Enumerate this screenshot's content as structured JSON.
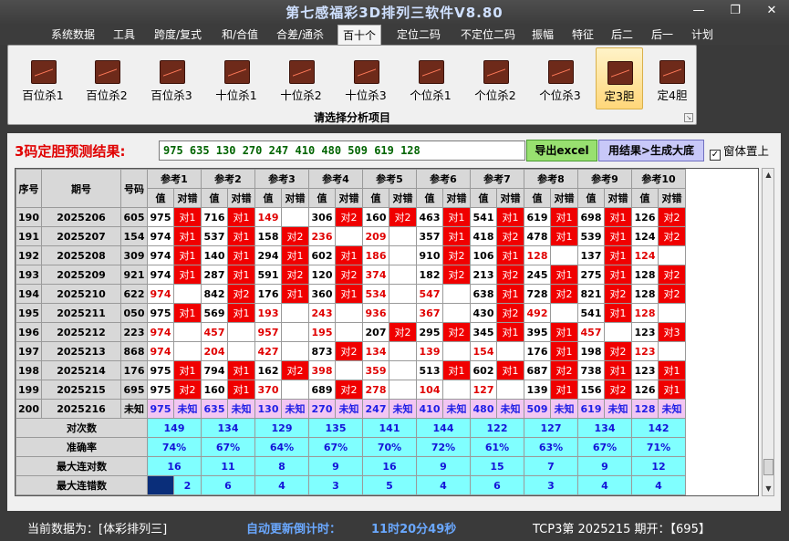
{
  "window": {
    "title": "第七感福彩3D排列三软件V8.80"
  },
  "menu": [
    "系统数据",
    "工具",
    "跨度/复式",
    "和/合值",
    "合差/通杀",
    "百十个",
    "定位二码",
    "不定位二码",
    "振幅",
    "特征",
    "后二",
    "后一",
    "计划"
  ],
  "menu_active": 5,
  "ribbon": {
    "buttons": [
      "百位杀1",
      "百位杀2",
      "百位杀3",
      "十位杀1",
      "十位杀2",
      "十位杀3",
      "个位杀1",
      "个位杀2",
      "个位杀3",
      "定3胆",
      "定4胆"
    ],
    "selected": 9,
    "caption": "请选择分析项目"
  },
  "result": {
    "label": "3码定胆预测结果:",
    "value": "975 635 130 270 247 410 480 509 619 128",
    "excel_button": "导出excel",
    "gen_button": "用结果>生成大底",
    "topmost_label": "窗体置上"
  },
  "table": {
    "headers": {
      "seq": "序号",
      "period": "期号",
      "code": "号码",
      "val": "值",
      "match": "对错"
    },
    "refs": [
      "参考1",
      "参考2",
      "参考3",
      "参考4",
      "参考5",
      "参考6",
      "参考7",
      "参考8",
      "参考9",
      "参考10"
    ],
    "rows": [
      {
        "seq": "190",
        "period": "2025206",
        "code": "605",
        "cells": [
          [
            "975",
            "对1"
          ],
          [
            "716",
            "对1"
          ],
          [
            "149",
            ""
          ],
          [
            "306",
            "对2"
          ],
          [
            "160",
            "对2"
          ],
          [
            "463",
            "对1"
          ],
          [
            "541",
            "对1"
          ],
          [
            "619",
            "对1"
          ],
          [
            "698",
            "对1"
          ],
          [
            "126",
            "对2"
          ]
        ]
      },
      {
        "seq": "191",
        "period": "2025207",
        "code": "154",
        "cells": [
          [
            "974",
            "对1"
          ],
          [
            "537",
            "对1"
          ],
          [
            "158",
            "对2"
          ],
          [
            "236",
            ""
          ],
          [
            "209",
            ""
          ],
          [
            "357",
            "对1"
          ],
          [
            "418",
            "对2"
          ],
          [
            "478",
            "对1"
          ],
          [
            "539",
            "对1"
          ],
          [
            "124",
            "对2"
          ]
        ]
      },
      {
        "seq": "192",
        "period": "2025208",
        "code": "309",
        "cells": [
          [
            "974",
            "对1"
          ],
          [
            "140",
            "对1"
          ],
          [
            "294",
            "对1"
          ],
          [
            "602",
            "对1"
          ],
          [
            "186",
            ""
          ],
          [
            "910",
            "对2"
          ],
          [
            "106",
            "对1"
          ],
          [
            "128",
            ""
          ],
          [
            "137",
            "对1"
          ],
          [
            "124",
            ""
          ]
        ]
      },
      {
        "seq": "193",
        "period": "2025209",
        "code": "921",
        "cells": [
          [
            "974",
            "对1"
          ],
          [
            "287",
            "对1"
          ],
          [
            "591",
            "对2"
          ],
          [
            "120",
            "对2"
          ],
          [
            "374",
            ""
          ],
          [
            "182",
            "对2"
          ],
          [
            "213",
            "对2"
          ],
          [
            "245",
            "对1"
          ],
          [
            "275",
            "对1"
          ],
          [
            "128",
            "对2"
          ]
        ]
      },
      {
        "seq": "194",
        "period": "2025210",
        "code": "622",
        "cells": [
          [
            "974",
            ""
          ],
          [
            "842",
            "对2"
          ],
          [
            "176",
            "对1"
          ],
          [
            "360",
            "对1"
          ],
          [
            "534",
            ""
          ],
          [
            "547",
            ""
          ],
          [
            "638",
            "对1"
          ],
          [
            "728",
            "对2"
          ],
          [
            "821",
            "对2"
          ],
          [
            "128",
            "对2"
          ]
        ]
      },
      {
        "seq": "195",
        "period": "2025211",
        "code": "050",
        "cells": [
          [
            "975",
            "对1"
          ],
          [
            "569",
            "对1"
          ],
          [
            "193",
            ""
          ],
          [
            "243",
            ""
          ],
          [
            "936",
            ""
          ],
          [
            "367",
            ""
          ],
          [
            "430",
            "对2"
          ],
          [
            "492",
            ""
          ],
          [
            "541",
            "对1"
          ],
          [
            "128",
            ""
          ]
        ]
      },
      {
        "seq": "196",
        "period": "2025212",
        "code": "223",
        "cells": [
          [
            "974",
            ""
          ],
          [
            "457",
            ""
          ],
          [
            "957",
            ""
          ],
          [
            "195",
            ""
          ],
          [
            "207",
            "对2"
          ],
          [
            "295",
            "对2"
          ],
          [
            "345",
            "对1"
          ],
          [
            "395",
            "对1"
          ],
          [
            "457",
            ""
          ],
          [
            "123",
            "对3"
          ]
        ]
      },
      {
        "seq": "197",
        "period": "2025213",
        "code": "868",
        "cells": [
          [
            "974",
            ""
          ],
          [
            "204",
            ""
          ],
          [
            "427",
            ""
          ],
          [
            "873",
            "对2"
          ],
          [
            "134",
            ""
          ],
          [
            "139",
            ""
          ],
          [
            "154",
            ""
          ],
          [
            "176",
            "对1"
          ],
          [
            "198",
            "对2"
          ],
          [
            "123",
            ""
          ]
        ]
      },
      {
        "seq": "198",
        "period": "2025214",
        "code": "176",
        "cells": [
          [
            "975",
            "对1"
          ],
          [
            "794",
            "对1"
          ],
          [
            "162",
            "对2"
          ],
          [
            "398",
            ""
          ],
          [
            "359",
            ""
          ],
          [
            "513",
            "对1"
          ],
          [
            "602",
            "对1"
          ],
          [
            "687",
            "对2"
          ],
          [
            "738",
            "对1"
          ],
          [
            "123",
            "对1"
          ]
        ]
      },
      {
        "seq": "199",
        "period": "2025215",
        "code": "695",
        "cells": [
          [
            "975",
            "对2"
          ],
          [
            "160",
            "对1"
          ],
          [
            "370",
            ""
          ],
          [
            "689",
            "对2"
          ],
          [
            "278",
            ""
          ],
          [
            "104",
            ""
          ],
          [
            "127",
            ""
          ],
          [
            "139",
            "对1"
          ],
          [
            "156",
            "对2"
          ],
          [
            "126",
            "对1"
          ]
        ]
      }
    ],
    "predict": {
      "seq": "200",
      "period": "2025216",
      "code": "未知",
      "cells": [
        [
          "975",
          "未知"
        ],
        [
          "635",
          "未知"
        ],
        [
          "130",
          "未知"
        ],
        [
          "270",
          "未知"
        ],
        [
          "247",
          "未知"
        ],
        [
          "410",
          "未知"
        ],
        [
          "480",
          "未知"
        ],
        [
          "509",
          "未知"
        ],
        [
          "619",
          "未知"
        ],
        [
          "128",
          "未知"
        ]
      ]
    },
    "stats": [
      {
        "label": "对次数",
        "values": [
          "149",
          "134",
          "129",
          "135",
          "141",
          "144",
          "122",
          "127",
          "134",
          "142"
        ]
      },
      {
        "label": "准确率",
        "values": [
          "74%",
          "67%",
          "64%",
          "67%",
          "70%",
          "72%",
          "61%",
          "63%",
          "67%",
          "71%"
        ]
      },
      {
        "label": "最大连对数",
        "values": [
          "16",
          "11",
          "8",
          "9",
          "16",
          "9",
          "15",
          "7",
          "9",
          "12"
        ]
      },
      {
        "label": "最大连错数",
        "values": [
          "2",
          "6",
          "4",
          "3",
          "5",
          "4",
          "6",
          "3",
          "4",
          "4"
        ]
      }
    ]
  },
  "status": {
    "data_label": "当前数据为：[体彩排列三]",
    "countdown_label": "自动更新倒计时：",
    "countdown_value": "11时20分49秒",
    "draw_info": "TCP3第 2025215 期开：【695】"
  },
  "colors": {
    "hit": "#f00000",
    "miss_value": "#e00000",
    "predict_row": "#f2c6f2",
    "stats_cell": "#80ffff",
    "result_text": "#006400"
  }
}
